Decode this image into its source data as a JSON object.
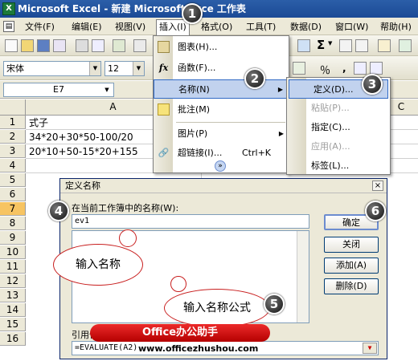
{
  "window": {
    "title": "Microsoft Excel - 新建 Microsoft Exce  工作表",
    "app_icon": "excel-icon"
  },
  "menubar": {
    "items": [
      "文件(F)",
      "编辑(E)",
      "视图(V)",
      "插入(I)",
      "格式(O)",
      "工具(T)",
      "数据(D)",
      "窗口(W)",
      "帮助(H)"
    ],
    "active": "插入(I)"
  },
  "toolbar": {
    "font_name": "宋体",
    "font_size": "12"
  },
  "namebox": {
    "value": "E7"
  },
  "grid": {
    "col_a": "A",
    "col_c_partial": "C",
    "rows": [
      "1",
      "2",
      "3",
      "4",
      "5",
      "6",
      "7",
      "8",
      "9",
      "10",
      "11",
      "12",
      "13",
      "14",
      "15",
      "16"
    ],
    "selected_row": "7",
    "cells": [
      "式子",
      "34*20+30*50-100/20",
      "20*10+50-15*20+155"
    ]
  },
  "insert_menu": {
    "items": [
      {
        "label": "图表(H)...",
        "icon": "chart-icon"
      },
      {
        "label": "函数(F)...",
        "icon": "function-icon"
      },
      {
        "label": "名称(N)",
        "submenu": true,
        "highlighted": true
      },
      {
        "label": "批注(M)",
        "icon": "comment-icon"
      },
      {
        "label": "图片(P)",
        "submenu": true
      },
      {
        "label": "超链接(I)...",
        "shortcut": "Ctrl+K",
        "icon": "hyperlink-icon"
      }
    ],
    "expand": "»"
  },
  "name_submenu": {
    "items": [
      {
        "label": "定义(D)...",
        "highlighted": true
      },
      {
        "label": "粘贴(P)...",
        "disabled": true
      },
      {
        "label": "指定(C)..."
      },
      {
        "label": "应用(A)...",
        "disabled": true
      },
      {
        "label": "标签(L)..."
      }
    ]
  },
  "dialog": {
    "title": "定义名称",
    "close": "×",
    "names_label": "在当前工作簿中的名称(W):",
    "name_value": "ev1",
    "ref_label": "引用位置(R):",
    "ref_value": "=EVALUATE(A2)",
    "buttons": {
      "ok": "确定",
      "close": "关闭",
      "add": "添加(A)",
      "delete": "删除(D)"
    }
  },
  "annotations": {
    "bubble_name": "输入名称",
    "bubble_formula": "输入名称公式",
    "badges": [
      "1",
      "2",
      "3",
      "4",
      "5",
      "6"
    ]
  },
  "watermark": {
    "brand": "Office办公助手",
    "url": "www.officezhushou.com"
  },
  "colors": {
    "title_bar": "#1b4a96",
    "highlight": "#c1d2ee",
    "selected_row": "#f7c462",
    "callout_border": "#c81e1e",
    "brand_red": "#d01010"
  }
}
